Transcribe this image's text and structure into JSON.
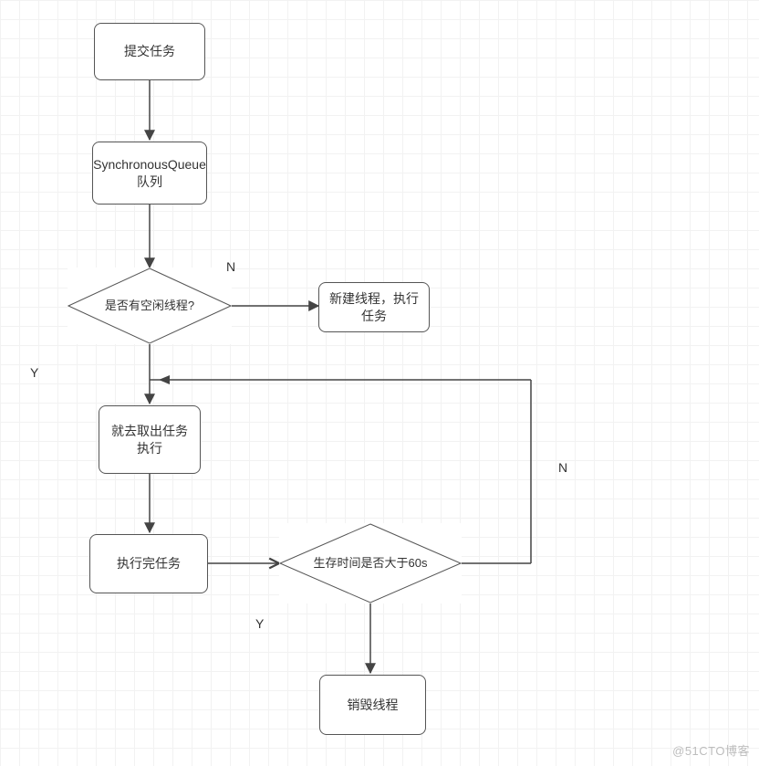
{
  "chart_data": {
    "type": "flowchart",
    "nodes": [
      {
        "id": "n1",
        "shape": "rounded-rect",
        "text": "提交任务"
      },
      {
        "id": "n2",
        "shape": "rounded-rect",
        "text": "SynchronousQueue队列"
      },
      {
        "id": "d1",
        "shape": "diamond",
        "text": "是否有空闲线程?"
      },
      {
        "id": "n3",
        "shape": "rounded-rect",
        "text": "新建线程，执行任务"
      },
      {
        "id": "n4",
        "shape": "rounded-rect",
        "text": "就去取出任务执行"
      },
      {
        "id": "n5",
        "shape": "rounded-rect",
        "text": "执行完任务"
      },
      {
        "id": "d2",
        "shape": "diamond",
        "text": "生存时间是否大于60s"
      },
      {
        "id": "n6",
        "shape": "rounded-rect",
        "text": "销毁线程"
      }
    ],
    "edges": [
      {
        "from": "n1",
        "to": "n2"
      },
      {
        "from": "n2",
        "to": "d1"
      },
      {
        "from": "d1",
        "to": "n3",
        "label": "N"
      },
      {
        "from": "d1",
        "to": "n4",
        "label": "Y"
      },
      {
        "from": "n4",
        "to": "n5"
      },
      {
        "from": "n5",
        "to": "d2"
      },
      {
        "from": "d2",
        "to": "n6",
        "label": "Y"
      },
      {
        "from": "d2",
        "to": "n4",
        "label": "N",
        "note": "loops back above n4"
      }
    ]
  },
  "nodes": {
    "n1": "提交任务",
    "n2": "SynchronousQueue队列",
    "d1": "是否有空闲线程?",
    "n3": "新建线程，执行任务",
    "n4": "就去取出任务执行",
    "n5": "执行完任务",
    "d2": "生存时间是否大于60s",
    "n6": "销毁线程"
  },
  "labels": {
    "d1_no": "N",
    "d1_yes": "Y",
    "d2_no": "N",
    "d2_yes": "Y"
  },
  "watermark": "@51CTO博客"
}
